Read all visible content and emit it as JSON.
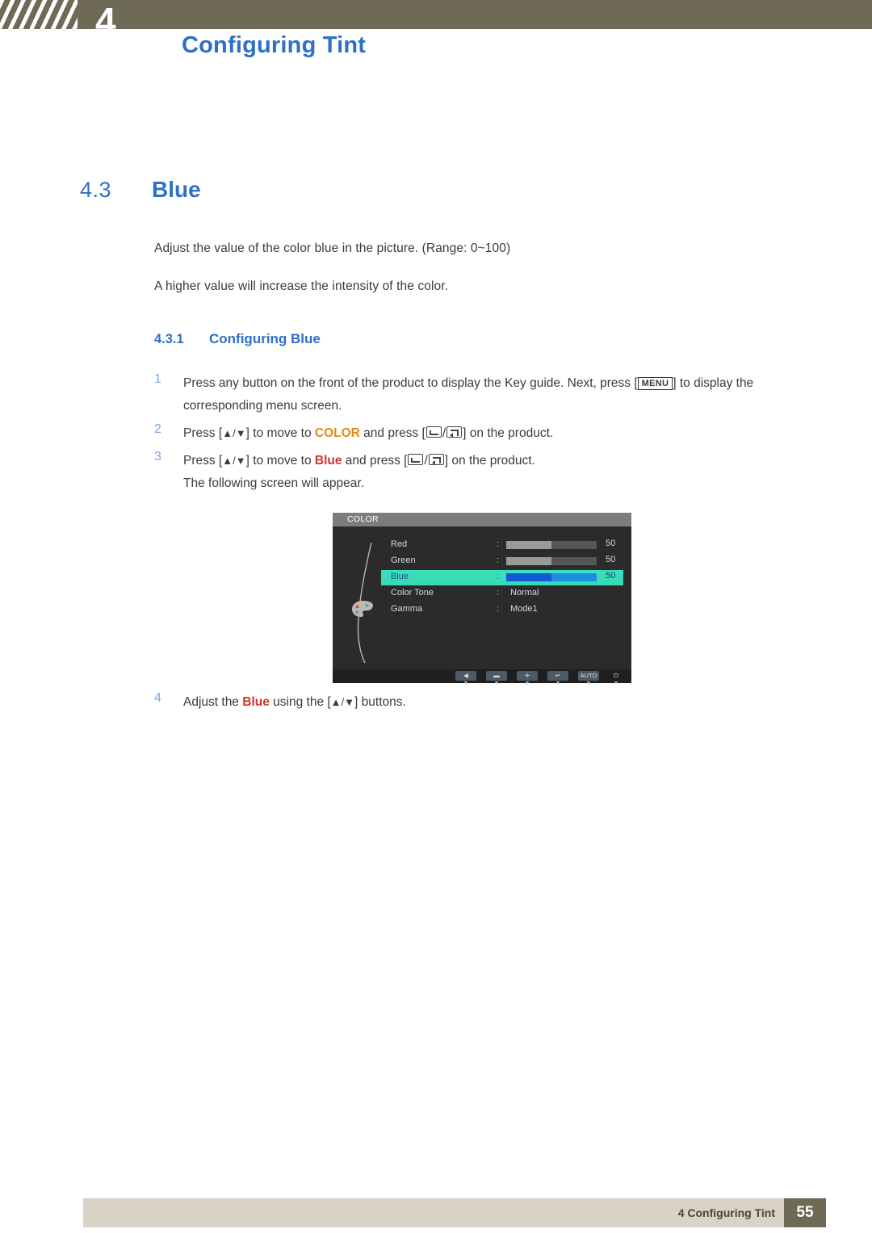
{
  "header": {
    "chapter_number": "4",
    "title": "Configuring Tint"
  },
  "section": {
    "number": "4.3",
    "title": "Blue",
    "paragraph_1": "Adjust the value of the color blue in the picture. (Range: 0~100)",
    "paragraph_2": "A higher value will increase the intensity of the color."
  },
  "subsection": {
    "number": "4.3.1",
    "title": "Configuring Blue"
  },
  "steps": {
    "s1_num": "1",
    "s1_a": "Press any button on the front of the product to display the Key guide. Next, press [",
    "s1_menu": "MENU",
    "s1_b": "] to display the corresponding menu screen.",
    "s2_num": "2",
    "s2_a": "Press [",
    "s2_updown": "▲/▼",
    "s2_b": "] to move to ",
    "s2_kw": "COLOR",
    "s2_c": " and press [",
    "s2_d": "] on the product.",
    "s3_num": "3",
    "s3_a": "Press [",
    "s3_updown": "▲/▼",
    "s3_b": "] to move to ",
    "s3_kw": "Blue",
    "s3_c": " and press [",
    "s3_d": "] on the product.",
    "s3_note": "The following screen will appear.",
    "s4_num": "4",
    "s4_a": "Adjust the ",
    "s4_kw": "Blue",
    "s4_b": " using the [",
    "s4_updown": "▲/▼",
    "s4_c": "] buttons."
  },
  "osd": {
    "title": "COLOR",
    "rows": [
      {
        "label": "Red",
        "colon": ":",
        "type": "bar",
        "value": "50",
        "fill_pct": 50
      },
      {
        "label": "Green",
        "colon": ":",
        "type": "bar",
        "value": "50",
        "fill_pct": 50
      },
      {
        "label": "Blue",
        "colon": ":",
        "type": "bar",
        "value": "50",
        "fill_pct": 50,
        "selected": true
      },
      {
        "label": "Color Tone",
        "colon": ":",
        "type": "text",
        "value": "Normal"
      },
      {
        "label": "Gamma",
        "colon": ":",
        "type": "text",
        "value": "Mode1"
      }
    ],
    "buttons": [
      {
        "name": "back",
        "glyph": "◀"
      },
      {
        "name": "minus",
        "glyph": "▬"
      },
      {
        "name": "plus",
        "glyph": "✛"
      },
      {
        "name": "enter",
        "glyph": "↵"
      },
      {
        "name": "auto",
        "glyph": "AUTO"
      },
      {
        "name": "power",
        "glyph": "⏻"
      }
    ]
  },
  "footer": {
    "text": "4 Configuring Tint",
    "page": "55"
  }
}
